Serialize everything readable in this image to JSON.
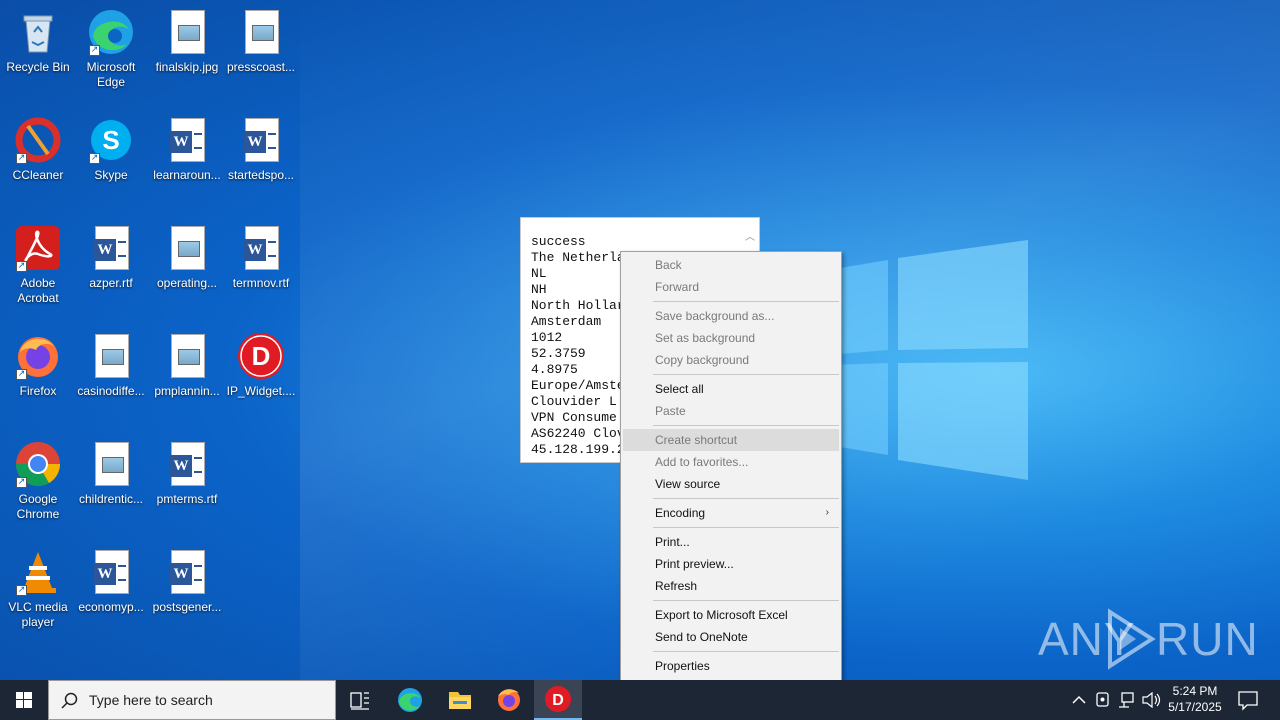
{
  "desktop_icons": [
    {
      "label": "Recycle Bin",
      "icon": "recycle-bin-icon"
    },
    {
      "label": "Microsoft Edge",
      "icon": "edge-icon"
    },
    {
      "label": "finalskip.jpg",
      "icon": "image-file-icon"
    },
    {
      "label": "presscoast...",
      "icon": "image-file-icon"
    },
    {
      "label": "CCleaner",
      "icon": "ccleaner-icon"
    },
    {
      "label": "Skype",
      "icon": "skype-icon"
    },
    {
      "label": "learnaroun...",
      "icon": "word-doc-icon"
    },
    {
      "label": "startedspo...",
      "icon": "word-doc-icon"
    },
    {
      "label": "Adobe Acrobat",
      "icon": "acrobat-icon"
    },
    {
      "label": "azper.rtf",
      "icon": "word-doc-icon"
    },
    {
      "label": "operating...",
      "icon": "image-file-icon"
    },
    {
      "label": "termnov.rtf",
      "icon": "word-doc-icon"
    },
    {
      "label": "Firefox",
      "icon": "firefox-icon"
    },
    {
      "label": "casinodiffe...",
      "icon": "image-file-icon"
    },
    {
      "label": "pmplannin...",
      "icon": "image-file-icon"
    },
    {
      "label": "IP_Widget....",
      "icon": "ip-widget-icon"
    },
    {
      "label": "Google Chrome",
      "icon": "chrome-icon"
    },
    {
      "label": "childrentic...",
      "icon": "image-file-icon"
    },
    {
      "label": "pmterms.rtf",
      "icon": "word-doc-icon"
    },
    {
      "label": "VLC media player",
      "icon": "vlc-icon"
    },
    {
      "label": "economyp...",
      "icon": "word-doc-icon"
    },
    {
      "label": "postsgener...",
      "icon": "word-doc-icon"
    }
  ],
  "popup": {
    "lines": [
      "success",
      "The Netherla",
      "NL",
      "NH",
      "North Hollar",
      "Amsterdam",
      "1012",
      "52.3759",
      "4.8975",
      "Europe/Amste",
      "Clouvider L",
      "VPN Consume",
      "AS62240 Clov",
      "45.128.199.2"
    ]
  },
  "context_menu": {
    "items": [
      {
        "label": "Back",
        "disabled": true
      },
      {
        "label": "Forward",
        "disabled": true
      },
      {
        "label": "Save background as...",
        "disabled": true
      },
      {
        "label": "Set as background",
        "disabled": true
      },
      {
        "label": "Copy background",
        "disabled": true
      },
      {
        "label": "Select all",
        "disabled": false
      },
      {
        "label": "Paste",
        "disabled": true
      },
      {
        "label": "Create shortcut",
        "disabled": true,
        "highlighted": true
      },
      {
        "label": "Add to favorites...",
        "disabled": true
      },
      {
        "label": "View source",
        "disabled": false
      },
      {
        "label": "Encoding",
        "disabled": false,
        "submenu": true
      },
      {
        "label": "Print...",
        "disabled": false
      },
      {
        "label": "Print preview...",
        "disabled": false
      },
      {
        "label": "Refresh",
        "disabled": false
      },
      {
        "label": "Export to Microsoft Excel",
        "disabled": false
      },
      {
        "label": "Send to OneNote",
        "disabled": false
      },
      {
        "label": "Properties",
        "disabled": false
      }
    ]
  },
  "watermark": {
    "left": "ANY",
    "right": "RUN"
  },
  "taskbar": {
    "search_placeholder": "Type here to search",
    "time": "5:24 PM",
    "date": "5/17/2025",
    "pinned": [
      "task-view-icon",
      "edge-icon",
      "file-explorer-icon",
      "firefox-icon",
      "ip-widget-icon"
    ]
  },
  "colors": {
    "accent": "#0b63c8",
    "taskbar": "#1c2634"
  }
}
